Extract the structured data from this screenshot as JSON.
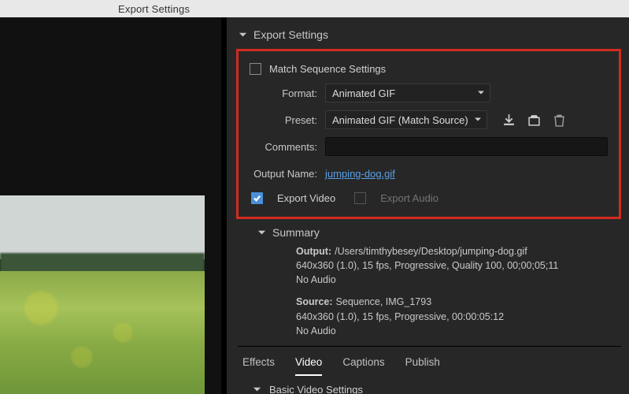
{
  "window": {
    "title": "Export Settings"
  },
  "section": {
    "title": "Export Settings"
  },
  "matchSeq": {
    "label": "Match Sequence Settings",
    "checked": false
  },
  "format": {
    "label": "Format:",
    "value": "Animated GIF"
  },
  "preset": {
    "label": "Preset:",
    "value": "Animated GIF (Match Source)"
  },
  "comments": {
    "label": "Comments:",
    "value": ""
  },
  "outputName": {
    "label": "Output Name:",
    "value": "jumping-dog.gif"
  },
  "exportVideo": {
    "label": "Export Video",
    "checked": true
  },
  "exportAudio": {
    "label": "Export Audio",
    "checked": false
  },
  "summary": {
    "title": "Summary",
    "outputLabel": "Output:",
    "outputPath": "/Users/timthybesey/Desktop/jumping-dog.gif",
    "outputLine2": "640x360 (1.0), 15 fps, Progressive, Quality 100, 00;00;05;11",
    "outputLine3": "No Audio",
    "sourceLabel": "Source:",
    "sourceLine1": "Sequence, IMG_1793",
    "sourceLine2": "640x360 (1.0), 15 fps, Progressive, 00:00:05:12",
    "sourceLine3": "No Audio"
  },
  "tabs": {
    "effects": "Effects",
    "video": "Video",
    "captions": "Captions",
    "publish": "Publish",
    "active": "video"
  },
  "basicVideo": {
    "title": "Basic Video Settings"
  }
}
